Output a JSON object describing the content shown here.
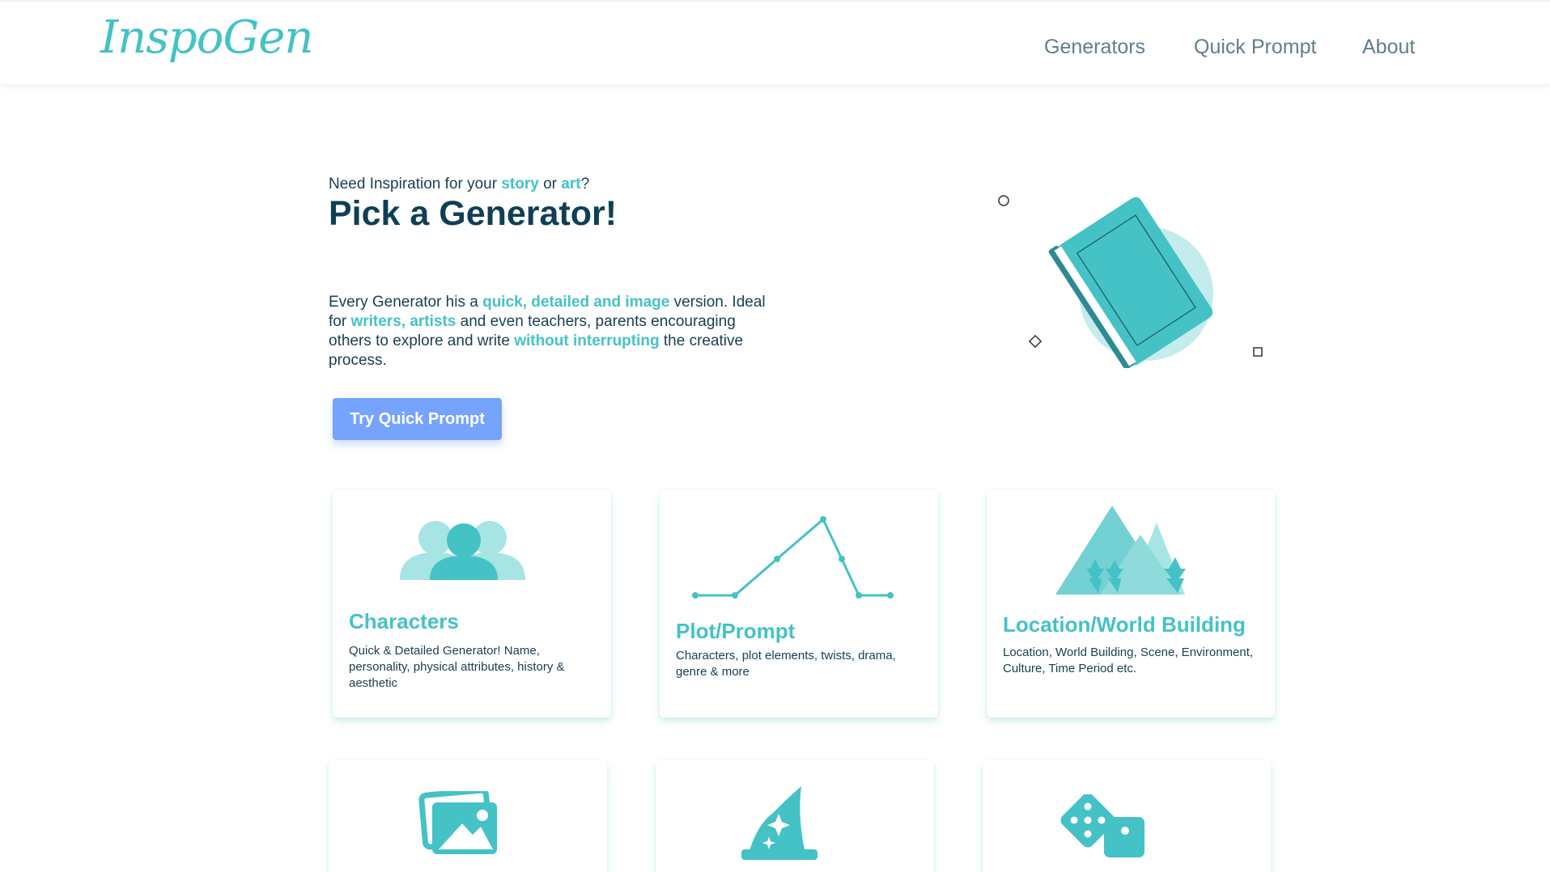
{
  "nav": {
    "logo": "InspoGen",
    "links": [
      "Generators",
      "Quick Prompt",
      "About"
    ]
  },
  "hero": {
    "kicker_prefix": "Need Inspiration for your ",
    "kicker_story": "story",
    "kicker_or": " or ",
    "kicker_art": "art",
    "kicker_suffix": "?",
    "title": "Pick a Generator!",
    "desc": {
      "p1": "Every Generator his a ",
      "a1": "quick, detailed and image",
      "p2": " version. Ideal for ",
      "a2": "writers, artists",
      "p3": " and even teachers, parents encouraging others to explore and write ",
      "a3": "without interrupting",
      "p4": " the creative process."
    },
    "cta_label": "Try Quick Prompt"
  },
  "cards": [
    {
      "title": "Characters",
      "desc": "Quick & Detailed Generator! Name, personality, physical attributes, history & aesthetic",
      "icon": "people-icon"
    },
    {
      "title": "Plot/Prompt",
      "desc": "Characters, plot elements, twists, drama, genre & more",
      "icon": "plot-graph-icon"
    },
    {
      "title": "Location/World Building",
      "desc": "Location, World Building, Scene, Environment, Culture, Time Period etc.",
      "icon": "mountains-icon"
    },
    {
      "icon": "images-icon"
    },
    {
      "icon": "wizard-hat-icon"
    },
    {
      "icon": "dice-icon"
    }
  ],
  "colors": {
    "accent": "#44c2c6",
    "accent_light": "#a7e4e4",
    "button": "#76a3fb",
    "text": "#173f52"
  }
}
